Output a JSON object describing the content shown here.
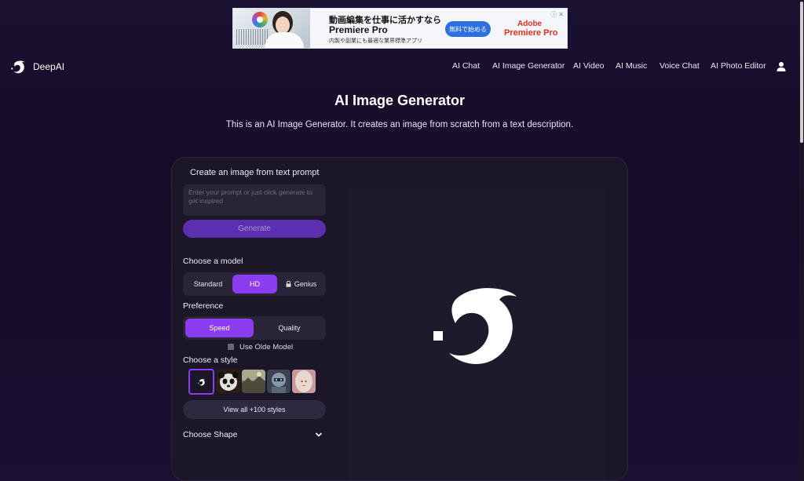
{
  "ad": {
    "headline_jp": "動画編集を仕事に活かすなら",
    "product": "Premiere Pro",
    "tagline_jp": "内製や副業にも最適な業界標準アプリ",
    "cta": "無料で始める",
    "brand_line1": "Adobe",
    "brand_line2": "Premiere Pro",
    "info_glyphs": "ⓘ ✕"
  },
  "header": {
    "brand": "DeepAI",
    "nav": [
      "AI Chat",
      "AI Image Generator",
      "AI Video",
      "AI Music",
      "Voice Chat",
      "AI Photo Editor"
    ]
  },
  "page": {
    "title": "AI Image Generator",
    "subtitle": "This is an AI Image Generator. It creates an image from scratch from a text description."
  },
  "form": {
    "prompt_heading": "Create an image from text prompt",
    "prompt_placeholder": "Enter your prompt or just click generate to get inspired",
    "generate_label": "Generate",
    "model_label": "Choose a model",
    "models": [
      "Standard",
      "HD",
      "Genius"
    ],
    "model_selected": "HD",
    "preference_label": "Preference",
    "preferences": [
      "Speed",
      "Quality"
    ],
    "preference_selected": "Speed",
    "olde_model_label": "Use Olde Model",
    "style_label": "Choose a style",
    "styles": [
      "deepai-logo",
      "panda",
      "landscape",
      "robot",
      "portrait"
    ],
    "view_all_label": "View all +100 styles",
    "shape_label": "Choose Shape"
  },
  "colors": {
    "accent": "#8c3cf0",
    "generate_bg": "#5b2fb0",
    "background": "#150c28"
  }
}
